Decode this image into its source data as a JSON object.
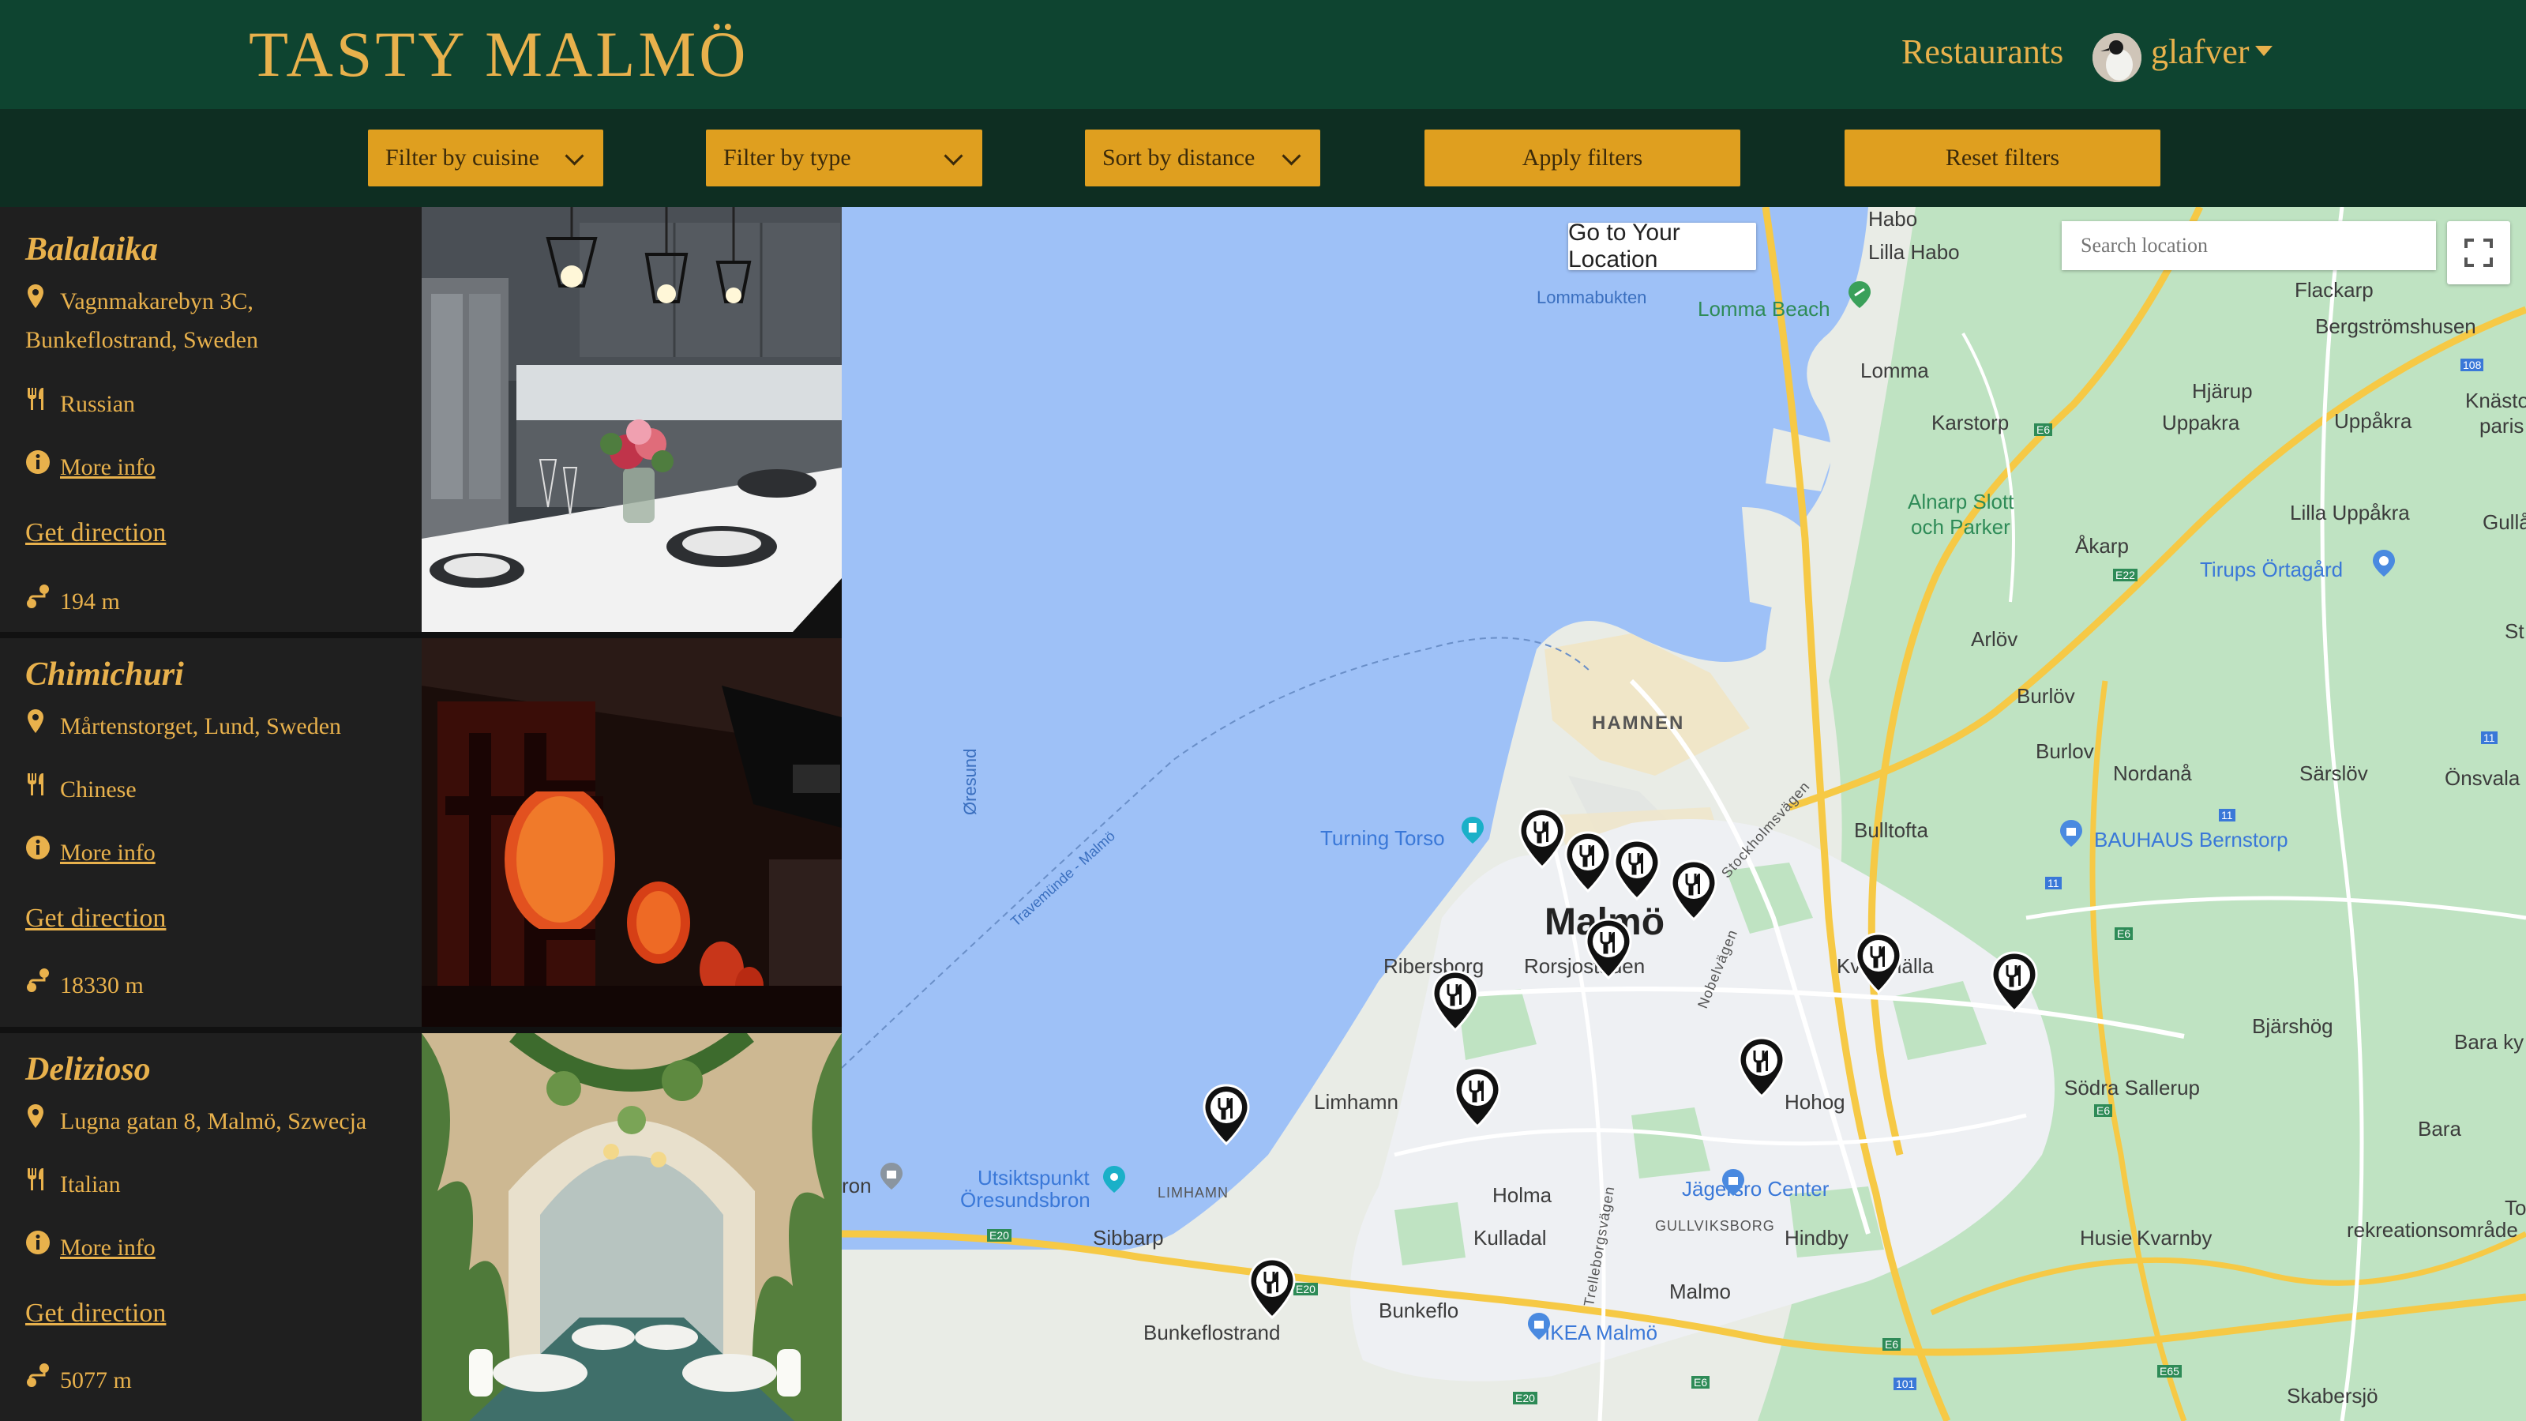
{
  "header": {
    "brand": "TASTY MALMÖ",
    "nav_restaurants": "Restaurants",
    "user_name": "glafver"
  },
  "filters": {
    "cuisine": "Filter by cuisine",
    "type": "Filter by type",
    "sort": "Sort by distance",
    "apply": "Apply filters",
    "reset": "Reset filters"
  },
  "restaurants": [
    {
      "name": "Balalaika",
      "address_line1": "Vagnmakarebyn 3C,",
      "address_line2": "Bunkeflostrand, Sweden",
      "cuisine": "Russian",
      "more_info": "More info",
      "get_direction": "Get direction",
      "distance": "194 m"
    },
    {
      "name": "Chimichuri",
      "address_line1": "Mårtenstorget, Lund, Sweden",
      "address_line2": "",
      "cuisine": "Chinese",
      "more_info": "More info",
      "get_direction": "Get direction",
      "distance": "18330 m"
    },
    {
      "name": "Delizioso",
      "address_line1": "Lugna gatan 8, Malmö, Szwecja",
      "address_line2": "",
      "cuisine": "Italian",
      "more_info": "More info",
      "get_direction": "Get direction",
      "distance": "5077 m"
    }
  ],
  "map": {
    "go_to_location": "Go to Your Location",
    "search_placeholder": "Search location",
    "labels": {
      "habo": "Habo",
      "lilla_habo": "Lilla Habo",
      "lommabukten": "Lommabukten",
      "lomma_beach": "Lomma Beach",
      "flackarp": "Flackarp",
      "bergstromshusen": "Bergströmshusen",
      "lomma": "Lomma",
      "hjarup": "Hjärup",
      "uppakra": "Uppakra",
      "uppakra2": "Uppåkra",
      "knasto": "Knästo",
      "paris": "paris",
      "karstorp": "Karstorp",
      "alnarp": "Alnarp Slott",
      "och_parker": "och Parker",
      "lilla_uppakra": "Lilla Uppåkra",
      "gullak": "Gullåk",
      "akarp": "Åkarp",
      "tirups": "Tirups Örtagård",
      "st": "St",
      "arlov": "Arlöv",
      "hamnen": "HAMNEN",
      "burlov1": "Burlöv",
      "burlov2": "Burlov",
      "nordana": "Nordanå",
      "sarslov": "Särslöv",
      "onsvala": "Önsvala",
      "oresund": "Øresund",
      "travemunde": "Travemünde - Malmö",
      "turning_torso": "Turning Torso",
      "bulltofta": "Bulltofta",
      "bauhaus": "BAUHAUS Bernstorp",
      "stockholmsvagen": "Stockholmsvägen",
      "malmo": "Malmö",
      "ribersborg": "Ribersborg",
      "rorsjostaden": "Rorsjostaden",
      "kirseberg": "Kulladal",
      "kvarnhalla": "Kvarnhälla",
      "bjarshog": "Bjärshög",
      "bara_ky": "Bara ky",
      "nobelvagen": "Nobelvägen",
      "limhamn": "Limhamn",
      "hohog": "Hohog",
      "sodra_sallerup": "Södra Sallerup",
      "bara": "Bara",
      "bron": "ron",
      "utsiktspunkt": "Utsiktspunkt",
      "oresundsbron": "Öresundsbron",
      "limhamn_small": "LIMHAMN",
      "holma": "Holma",
      "jagersro": "Jägersro Center",
      "toru": "Toru",
      "rekreation": "rekreationsområde",
      "sibbarp": "Sibbarp",
      "kulladal": "Kulladal",
      "gullviksborg": "GULLVIKSBORG",
      "hindby": "Hindby",
      "husie": "Husie",
      "kvarnby": "Kvarnby",
      "trelleborgsvagen": "Trelleborgsvägen",
      "malmo2": "Malmo",
      "bunkeflo": "Bunkeflo",
      "bunkeflostrand": "Bunkeflostrand",
      "ikea": "IKEA Malmö",
      "skabersjo": "Skabersjö",
      "e6": "E6",
      "e20": "E20",
      "e22": "E22",
      "e65": "E65",
      "r11": "11",
      "r108": "108",
      "r101": "101"
    }
  },
  "colors": {
    "header_bg": "#0e4430",
    "accent": "#df9f1f",
    "text_gold": "#e8b14c",
    "water": "#9ec1f7",
    "land": "#e9ece6",
    "park": "#bfe3c2"
  }
}
